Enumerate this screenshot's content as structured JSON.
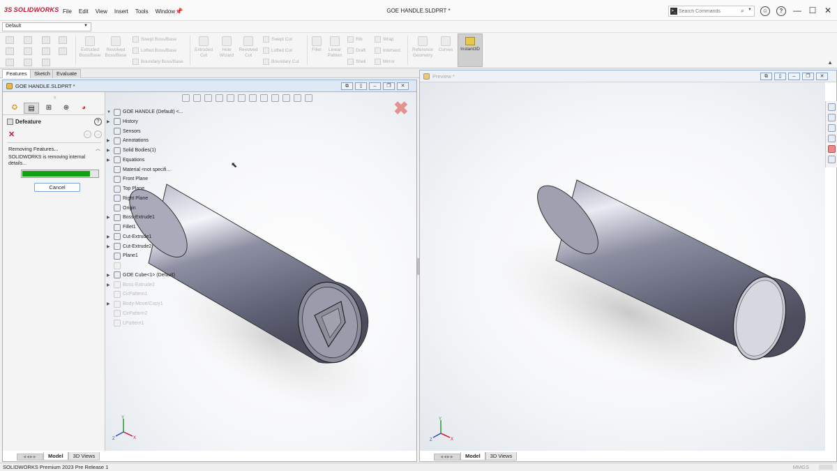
{
  "app": {
    "logo_text": "SOLIDWORKS",
    "document_title": "GOE HANDLE.SLDPRT *",
    "menu": [
      "File",
      "Edit",
      "View",
      "Insert",
      "Tools",
      "Window"
    ],
    "search_placeholder": "Search Commands",
    "win_controls": {
      "minimize": "—",
      "maximize": "☐",
      "close": "✕"
    }
  },
  "config_select": "Default",
  "ribbon": {
    "big_buttons": [
      {
        "label": "Extruded\nBoss/Base"
      },
      {
        "label": "Revolved\nBoss/Base"
      },
      {
        "label": "Extruded\nCut"
      },
      {
        "label": "Hole\nWizard"
      },
      {
        "label": "Revolved\nCut"
      },
      {
        "label": "Fillet"
      },
      {
        "label": "Linear\nPattern"
      },
      {
        "label": "Reference\nGeometry"
      },
      {
        "label": "Curves"
      }
    ],
    "small_buttons": {
      "swept_boss": "Swept Boss/Base",
      "lofted_boss": "Lofted Boss/Base",
      "boundary_boss": "Boundary Boss/Base",
      "swept_cut": "Swept Cut",
      "lofted_cut": "Lofted Cut",
      "boundary_cut": "Boundary Cut",
      "rib": "Rib",
      "draft": "Draft",
      "shell": "Shell",
      "wrap": "Wrap",
      "intersect": "Intersect",
      "mirror": "Mirror"
    },
    "instant3d": "Instant3D"
  },
  "command_tabs": [
    "Features",
    "Sketch",
    "Evaluate"
  ],
  "left_window": {
    "title": "GOE HANDLE.SLDPRT *",
    "property_manager": {
      "title": "Defeature",
      "section_title": "Removing Features...",
      "message": "SOLIDWORKS is removing internal details...",
      "progress": 0.9,
      "cancel": "Cancel"
    },
    "tree": [
      {
        "label": "GOE HANDLE (Default) <...",
        "exp": "▼",
        "faded": false
      },
      {
        "label": "History",
        "exp": "▶",
        "faded": false
      },
      {
        "label": "Sensors",
        "exp": "",
        "faded": false
      },
      {
        "label": "Annotations",
        "exp": "▶",
        "faded": false
      },
      {
        "label": "Solid Bodies(1)",
        "exp": "▶",
        "faded": false
      },
      {
        "label": "Equations",
        "exp": "▶",
        "faded": false
      },
      {
        "label": "Material <not specifi...",
        "exp": "",
        "faded": false
      },
      {
        "label": "Front Plane",
        "exp": "",
        "faded": false
      },
      {
        "label": "Top Plane",
        "exp": "",
        "faded": false
      },
      {
        "label": "Right Plane",
        "exp": "",
        "faded": false
      },
      {
        "label": "Origin",
        "exp": "",
        "faded": false
      },
      {
        "label": "Boss-Extrude1",
        "exp": "▶",
        "faded": false
      },
      {
        "label": "Fillet1",
        "exp": "",
        "faded": false
      },
      {
        "label": "Cut-Extrude1",
        "exp": "▶",
        "faded": false
      },
      {
        "label": "Cut-Extrude2",
        "exp": "▶",
        "faded": false
      },
      {
        "label": "Plane1",
        "exp": "",
        "faded": false
      },
      {
        "label": "",
        "exp": "",
        "faded": true
      },
      {
        "label": "GOE Cube<1> (Default)",
        "exp": "▶",
        "faded": false
      },
      {
        "label": "Boss-Extrude2",
        "exp": "▶",
        "faded": true
      },
      {
        "label": "CirPattern1",
        "exp": "",
        "faded": true
      },
      {
        "label": "Body-Move/Copy1",
        "exp": "▶",
        "faded": true
      },
      {
        "label": "CirPattern2",
        "exp": "",
        "faded": true
      },
      {
        "label": "LPattern1",
        "exp": "",
        "faded": true
      }
    ],
    "bottom_tabs": [
      "Model",
      "3D Views"
    ]
  },
  "right_window": {
    "title": "Preview *",
    "bottom_tabs": [
      "Model",
      "3D Views"
    ]
  },
  "triad_labels": {
    "x": "X",
    "y": "Y",
    "z": "Z"
  },
  "status": {
    "left": "SOLIDWORKS Premium 2023 Pre Release 1",
    "right": "MMGS"
  },
  "colors": {
    "progress_fill": "#10a010",
    "brand_red": "#c8102e",
    "window_border": "#8fb2d8"
  }
}
